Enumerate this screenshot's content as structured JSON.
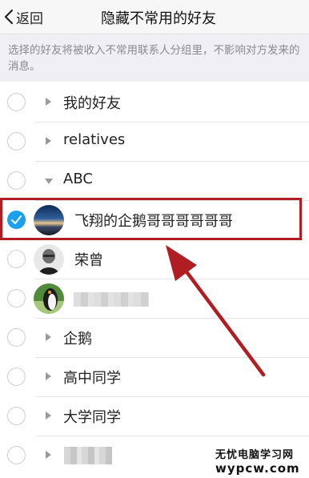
{
  "nav": {
    "back_label": "返回",
    "title": "隐藏不常用的好友"
  },
  "description": "选择的好友将被收入不常用联系人分组里，不影响对方发来的消息。",
  "groups": {
    "my_friends": "我的好友",
    "relatives": "relatives",
    "abc": "ABC",
    "qie": "企鹅",
    "high_school": "高中同学",
    "university": "大学同学"
  },
  "friends": {
    "selected": "飞翔的企鹅哥哥哥哥哥哥",
    "rongzeng": "荣曾"
  },
  "watermark": {
    "line1": "无忧电脑学习网",
    "line2": "wypcw.com"
  },
  "colors": {
    "accent": "#1aa0f0",
    "highlight": "#b01d22"
  }
}
